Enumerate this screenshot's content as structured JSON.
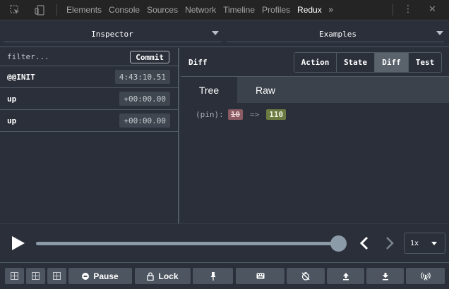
{
  "devtools": {
    "tabs": [
      {
        "label": "Elements",
        "active": false
      },
      {
        "label": "Console",
        "active": false
      },
      {
        "label": "Sources",
        "active": false
      },
      {
        "label": "Network",
        "active": false
      },
      {
        "label": "Timeline",
        "active": false
      },
      {
        "label": "Profiles",
        "active": false
      },
      {
        "label": "Redux",
        "active": true
      }
    ],
    "more_glyph": "»",
    "menu_glyph": "⋮",
    "close_glyph": "✕"
  },
  "selectors": {
    "left": "Inspector",
    "right": "Examples"
  },
  "action_list": {
    "filter_placeholder": "filter...",
    "commit_label": "Commit",
    "actions": [
      {
        "name": "@@INIT",
        "time": "4:43:10.51"
      },
      {
        "name": "up",
        "time": "+00:00.00"
      },
      {
        "name": "up",
        "time": "+00:00.00"
      }
    ]
  },
  "inspector": {
    "title": "Diff",
    "modes": [
      {
        "label": "Action",
        "active": false
      },
      {
        "label": "State",
        "active": false
      },
      {
        "label": "Diff",
        "active": true
      },
      {
        "label": "Test",
        "active": false
      }
    ],
    "subtabs": [
      {
        "label": "Tree",
        "active": true
      },
      {
        "label": "Raw",
        "active": false
      }
    ],
    "diff": {
      "key": "(pin):",
      "old_value": "10",
      "arrow": "=>",
      "new_value": "110"
    }
  },
  "slider": {
    "position_fraction": 1.0,
    "speed": "1x"
  },
  "buttons": {
    "pause_label": "Pause",
    "lock_label": "Lock"
  },
  "colors": {
    "background": "#2a2f3a",
    "border": "#4f5a65",
    "button": "#4c5560",
    "diff_removed": "#8b5b63",
    "diff_added": "#6b7a40",
    "slider": "#8c9ba8"
  }
}
